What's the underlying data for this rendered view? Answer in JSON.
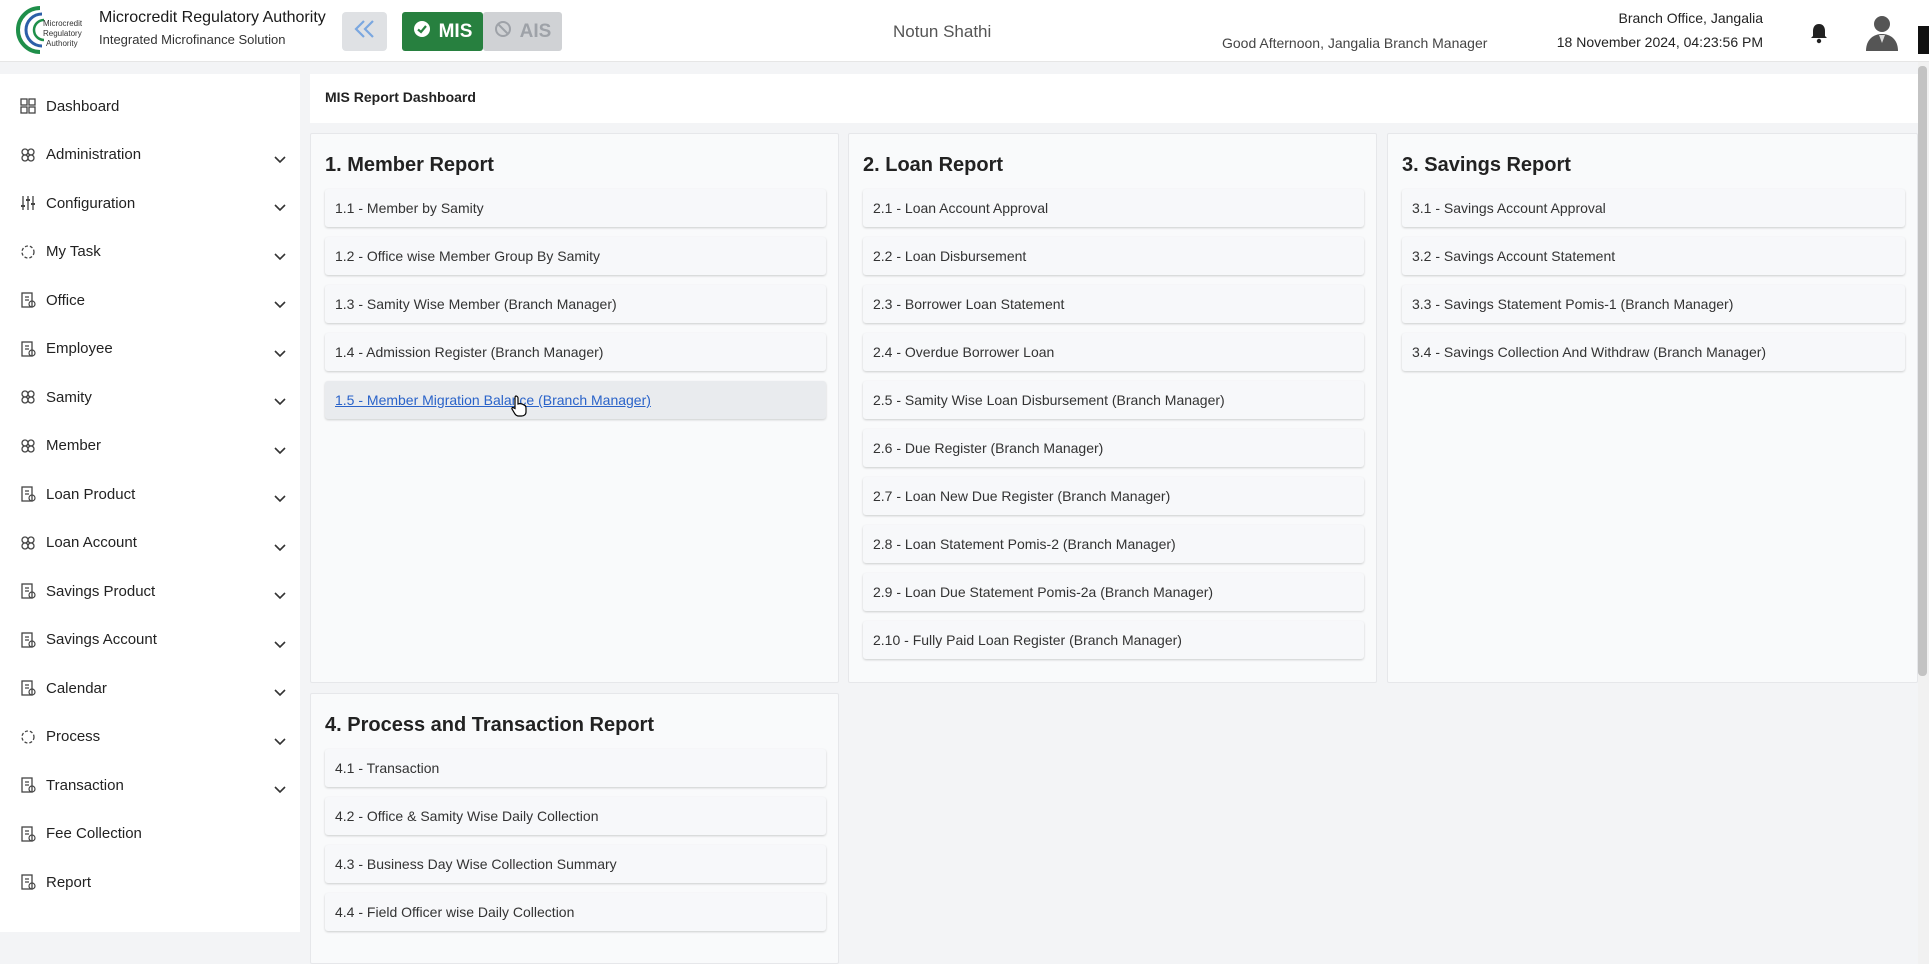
{
  "header": {
    "brand_title": "Microcredit Regulatory Authority",
    "brand_subtitle": "Integrated Microfinance Solution",
    "logo_text": "Microcredit Regulatory Authority",
    "mis_label": "MIS",
    "ais_label": "AIS",
    "center_title": "Notun Shathi",
    "greeting": "Good Afternoon, Jangalia Branch Manager",
    "branch": "Branch Office, Jangalia",
    "datetime": "18 November 2024, 04:23:56 PM",
    "accent_color": "#27803f"
  },
  "sidebar": {
    "items": [
      {
        "label": "Dashboard",
        "icon": "grid-icon",
        "expandable": false
      },
      {
        "label": "Administration",
        "icon": "admin-icon",
        "expandable": true
      },
      {
        "label": "Configuration",
        "icon": "sliders-icon",
        "expandable": true
      },
      {
        "label": "My Task",
        "icon": "task-icon",
        "expandable": true
      },
      {
        "label": "Office",
        "icon": "office-icon",
        "expandable": true
      },
      {
        "label": "Employee",
        "icon": "employee-icon",
        "expandable": true
      },
      {
        "label": "Samity",
        "icon": "samity-icon",
        "expandable": true
      },
      {
        "label": "Member",
        "icon": "member-icon",
        "expandable": true
      },
      {
        "label": "Loan Product",
        "icon": "loan-product-icon",
        "expandable": true
      },
      {
        "label": "Loan Account",
        "icon": "loan-account-icon",
        "expandable": true
      },
      {
        "label": "Savings Product",
        "icon": "savings-product-icon",
        "expandable": true
      },
      {
        "label": "Savings Account",
        "icon": "savings-account-icon",
        "expandable": true
      },
      {
        "label": "Calendar",
        "icon": "calendar-icon",
        "expandable": true
      },
      {
        "label": "Process",
        "icon": "process-icon",
        "expandable": true
      },
      {
        "label": "Transaction",
        "icon": "transaction-icon",
        "expandable": true
      },
      {
        "label": "Fee Collection",
        "icon": "fee-icon",
        "expandable": false
      },
      {
        "label": "Report",
        "icon": "report-icon",
        "expandable": false
      }
    ]
  },
  "main": {
    "page_title": "MIS Report Dashboard",
    "sections": [
      {
        "title": "1. Member Report",
        "items": [
          "1.1 - Member by Samity",
          "1.2 - Office wise Member Group By Samity",
          "1.3 - Samity Wise Member (Branch Manager)",
          "1.4 - Admission Register (Branch Manager)",
          "1.5 - Member Migration Balance (Branch Manager)"
        ]
      },
      {
        "title": "2. Loan Report",
        "items": [
          "2.1 - Loan Account Approval",
          "2.2 - Loan Disbursement",
          "2.3 - Borrower Loan Statement",
          "2.4 - Overdue Borrower Loan",
          "2.5 - Samity Wise Loan Disbursement (Branch Manager)",
          "2.6 - Due Register (Branch Manager)",
          "2.7 - Loan New Due Register (Branch Manager)",
          "2.8 - Loan Statement Pomis-2 (Branch Manager)",
          "2.9 - Loan Due Statement Pomis-2a (Branch Manager)",
          "2.10 - Fully Paid Loan Register (Branch Manager)"
        ]
      },
      {
        "title": "3. Savings Report",
        "items": [
          "3.1 - Savings Account Approval",
          "3.2 - Savings Account Statement",
          "3.3 - Savings Statement Pomis-1 (Branch Manager)",
          "3.4 - Savings Collection And Withdraw (Branch Manager)"
        ]
      },
      {
        "title": "4. Process and Transaction Report",
        "items": [
          "4.1 - Transaction",
          "4.2 - Office & Samity Wise Daily Collection",
          "4.3 - Business Day Wise Collection Summary",
          "4.4 - Field Officer wise Daily Collection"
        ]
      }
    ]
  }
}
